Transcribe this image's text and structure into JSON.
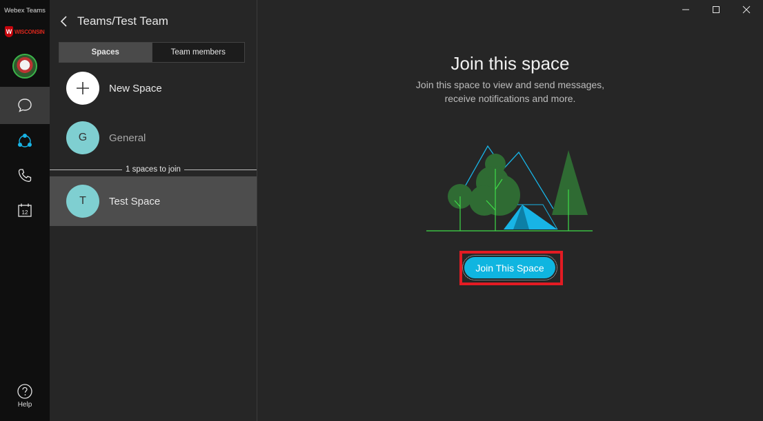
{
  "app": {
    "title": "Webex Teams",
    "org_logo_text": "WISCONSIN"
  },
  "rail": {
    "items": [
      {
        "name": "messaging",
        "icon": "chat-bubble-icon",
        "active": true
      },
      {
        "name": "teams",
        "icon": "teams-icon",
        "active": false
      },
      {
        "name": "calls",
        "icon": "phone-icon",
        "active": false
      },
      {
        "name": "meetings",
        "icon": "calendar-icon",
        "calendar_day": "12",
        "active": false
      }
    ],
    "help_label": "Help"
  },
  "panel": {
    "title": "Teams/Test Team",
    "tabs": [
      {
        "label": "Spaces",
        "active": true
      },
      {
        "label": "Team members",
        "active": false
      }
    ],
    "new_space": {
      "label": "New Space"
    },
    "spaces": [
      {
        "initial": "G",
        "name": "General"
      }
    ],
    "separator": "1 spaces to join",
    "join_spaces": [
      {
        "initial": "T",
        "name": "Test Space",
        "selected": true
      }
    ]
  },
  "main": {
    "title": "Join this space",
    "subtitle_line1": "Join this space to view and send messages,",
    "subtitle_line2": "receive notifications and more.",
    "join_button": "Join This Space"
  },
  "colors": {
    "accent": "#0fb5e0",
    "highlight": "#e31b23",
    "avatar_teal": "#7fcfd1",
    "presence_green": "#3bb54a"
  }
}
